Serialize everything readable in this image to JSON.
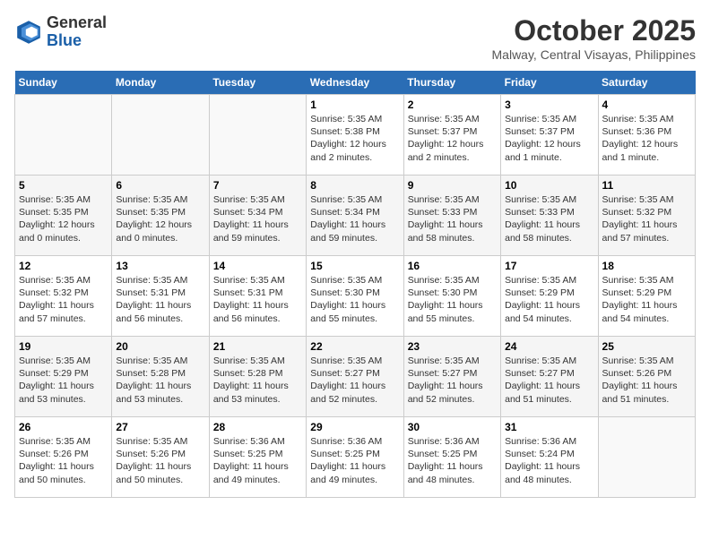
{
  "header": {
    "logo": {
      "general": "General",
      "blue": "Blue"
    },
    "title": "October 2025",
    "location": "Malway, Central Visayas, Philippines"
  },
  "days_of_week": [
    "Sunday",
    "Monday",
    "Tuesday",
    "Wednesday",
    "Thursday",
    "Friday",
    "Saturday"
  ],
  "weeks": [
    {
      "days": [
        {
          "number": "",
          "info": ""
        },
        {
          "number": "",
          "info": ""
        },
        {
          "number": "",
          "info": ""
        },
        {
          "number": "1",
          "info": "Sunrise: 5:35 AM\nSunset: 5:38 PM\nDaylight: 12 hours\nand 2 minutes."
        },
        {
          "number": "2",
          "info": "Sunrise: 5:35 AM\nSunset: 5:37 PM\nDaylight: 12 hours\nand 2 minutes."
        },
        {
          "number": "3",
          "info": "Sunrise: 5:35 AM\nSunset: 5:37 PM\nDaylight: 12 hours\nand 1 minute."
        },
        {
          "number": "4",
          "info": "Sunrise: 5:35 AM\nSunset: 5:36 PM\nDaylight: 12 hours\nand 1 minute."
        }
      ]
    },
    {
      "days": [
        {
          "number": "5",
          "info": "Sunrise: 5:35 AM\nSunset: 5:35 PM\nDaylight: 12 hours\nand 0 minutes."
        },
        {
          "number": "6",
          "info": "Sunrise: 5:35 AM\nSunset: 5:35 PM\nDaylight: 12 hours\nand 0 minutes."
        },
        {
          "number": "7",
          "info": "Sunrise: 5:35 AM\nSunset: 5:34 PM\nDaylight: 11 hours\nand 59 minutes."
        },
        {
          "number": "8",
          "info": "Sunrise: 5:35 AM\nSunset: 5:34 PM\nDaylight: 11 hours\nand 59 minutes."
        },
        {
          "number": "9",
          "info": "Sunrise: 5:35 AM\nSunset: 5:33 PM\nDaylight: 11 hours\nand 58 minutes."
        },
        {
          "number": "10",
          "info": "Sunrise: 5:35 AM\nSunset: 5:33 PM\nDaylight: 11 hours\nand 58 minutes."
        },
        {
          "number": "11",
          "info": "Sunrise: 5:35 AM\nSunset: 5:32 PM\nDaylight: 11 hours\nand 57 minutes."
        }
      ]
    },
    {
      "days": [
        {
          "number": "12",
          "info": "Sunrise: 5:35 AM\nSunset: 5:32 PM\nDaylight: 11 hours\nand 57 minutes."
        },
        {
          "number": "13",
          "info": "Sunrise: 5:35 AM\nSunset: 5:31 PM\nDaylight: 11 hours\nand 56 minutes."
        },
        {
          "number": "14",
          "info": "Sunrise: 5:35 AM\nSunset: 5:31 PM\nDaylight: 11 hours\nand 56 minutes."
        },
        {
          "number": "15",
          "info": "Sunrise: 5:35 AM\nSunset: 5:30 PM\nDaylight: 11 hours\nand 55 minutes."
        },
        {
          "number": "16",
          "info": "Sunrise: 5:35 AM\nSunset: 5:30 PM\nDaylight: 11 hours\nand 55 minutes."
        },
        {
          "number": "17",
          "info": "Sunrise: 5:35 AM\nSunset: 5:29 PM\nDaylight: 11 hours\nand 54 minutes."
        },
        {
          "number": "18",
          "info": "Sunrise: 5:35 AM\nSunset: 5:29 PM\nDaylight: 11 hours\nand 54 minutes."
        }
      ]
    },
    {
      "days": [
        {
          "number": "19",
          "info": "Sunrise: 5:35 AM\nSunset: 5:29 PM\nDaylight: 11 hours\nand 53 minutes."
        },
        {
          "number": "20",
          "info": "Sunrise: 5:35 AM\nSunset: 5:28 PM\nDaylight: 11 hours\nand 53 minutes."
        },
        {
          "number": "21",
          "info": "Sunrise: 5:35 AM\nSunset: 5:28 PM\nDaylight: 11 hours\nand 53 minutes."
        },
        {
          "number": "22",
          "info": "Sunrise: 5:35 AM\nSunset: 5:27 PM\nDaylight: 11 hours\nand 52 minutes."
        },
        {
          "number": "23",
          "info": "Sunrise: 5:35 AM\nSunset: 5:27 PM\nDaylight: 11 hours\nand 52 minutes."
        },
        {
          "number": "24",
          "info": "Sunrise: 5:35 AM\nSunset: 5:27 PM\nDaylight: 11 hours\nand 51 minutes."
        },
        {
          "number": "25",
          "info": "Sunrise: 5:35 AM\nSunset: 5:26 PM\nDaylight: 11 hours\nand 51 minutes."
        }
      ]
    },
    {
      "days": [
        {
          "number": "26",
          "info": "Sunrise: 5:35 AM\nSunset: 5:26 PM\nDaylight: 11 hours\nand 50 minutes."
        },
        {
          "number": "27",
          "info": "Sunrise: 5:35 AM\nSunset: 5:26 PM\nDaylight: 11 hours\nand 50 minutes."
        },
        {
          "number": "28",
          "info": "Sunrise: 5:36 AM\nSunset: 5:25 PM\nDaylight: 11 hours\nand 49 minutes."
        },
        {
          "number": "29",
          "info": "Sunrise: 5:36 AM\nSunset: 5:25 PM\nDaylight: 11 hours\nand 49 minutes."
        },
        {
          "number": "30",
          "info": "Sunrise: 5:36 AM\nSunset: 5:25 PM\nDaylight: 11 hours\nand 48 minutes."
        },
        {
          "number": "31",
          "info": "Sunrise: 5:36 AM\nSunset: 5:24 PM\nDaylight: 11 hours\nand 48 minutes."
        },
        {
          "number": "",
          "info": ""
        }
      ]
    }
  ]
}
